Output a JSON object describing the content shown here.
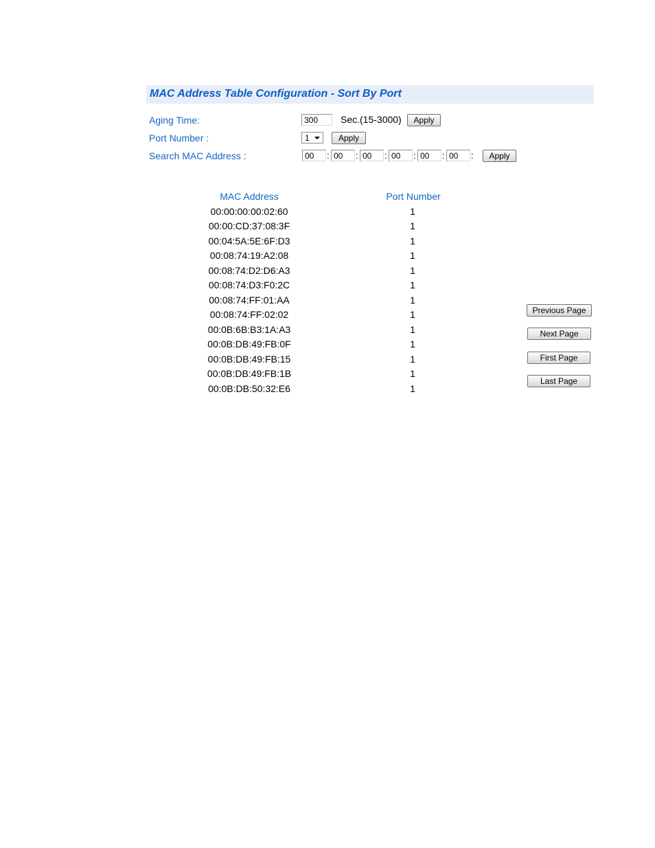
{
  "header": {
    "title": "MAC Address Table Configuration - Sort By Port"
  },
  "aging": {
    "label": "Aging Time:",
    "value": "300",
    "range": "Sec.(15-3000)",
    "apply": "Apply"
  },
  "port": {
    "label": "Port Number :",
    "selected": "1",
    "apply": "Apply"
  },
  "search": {
    "label": "Search MAC Address :",
    "octets": [
      "00",
      "00",
      "00",
      "00",
      "00",
      "00"
    ],
    "separator": ":",
    "apply": "Apply"
  },
  "table": {
    "headers": {
      "mac": "MAC Address",
      "port": "Port Number"
    },
    "rows": [
      {
        "mac": "00:00:00:00:02:60",
        "port": "1"
      },
      {
        "mac": "00:00:CD:37:08:3F",
        "port": "1"
      },
      {
        "mac": "00:04:5A:5E:6F:D3",
        "port": "1"
      },
      {
        "mac": "00:08:74:19:A2:08",
        "port": "1"
      },
      {
        "mac": "00:08:74:D2:D6:A3",
        "port": "1"
      },
      {
        "mac": "00:08:74:D3:F0:2C",
        "port": "1"
      },
      {
        "mac": "00:08:74:FF:01:AA",
        "port": "1"
      },
      {
        "mac": "00:08:74:FF:02:02",
        "port": "1"
      },
      {
        "mac": "00:0B:6B:B3:1A:A3",
        "port": "1"
      },
      {
        "mac": "00:0B:DB:49:FB:0F",
        "port": "1"
      },
      {
        "mac": "00:0B:DB:49:FB:15",
        "port": "1"
      },
      {
        "mac": "00:0B:DB:49:FB:1B",
        "port": "1"
      },
      {
        "mac": "00:0B:DB:50:32:E6",
        "port": "1"
      }
    ]
  },
  "paging": {
    "previous": "Previous Page",
    "next": "Next Page",
    "first": "First Page",
    "last": "Last Page"
  },
  "colors": {
    "heading": "#0b5fc4",
    "label": "#1565c8",
    "title_bar_bg": "#e8eef8"
  },
  "icons": {
    "port_select_arrow": "chevron-down-icon"
  }
}
